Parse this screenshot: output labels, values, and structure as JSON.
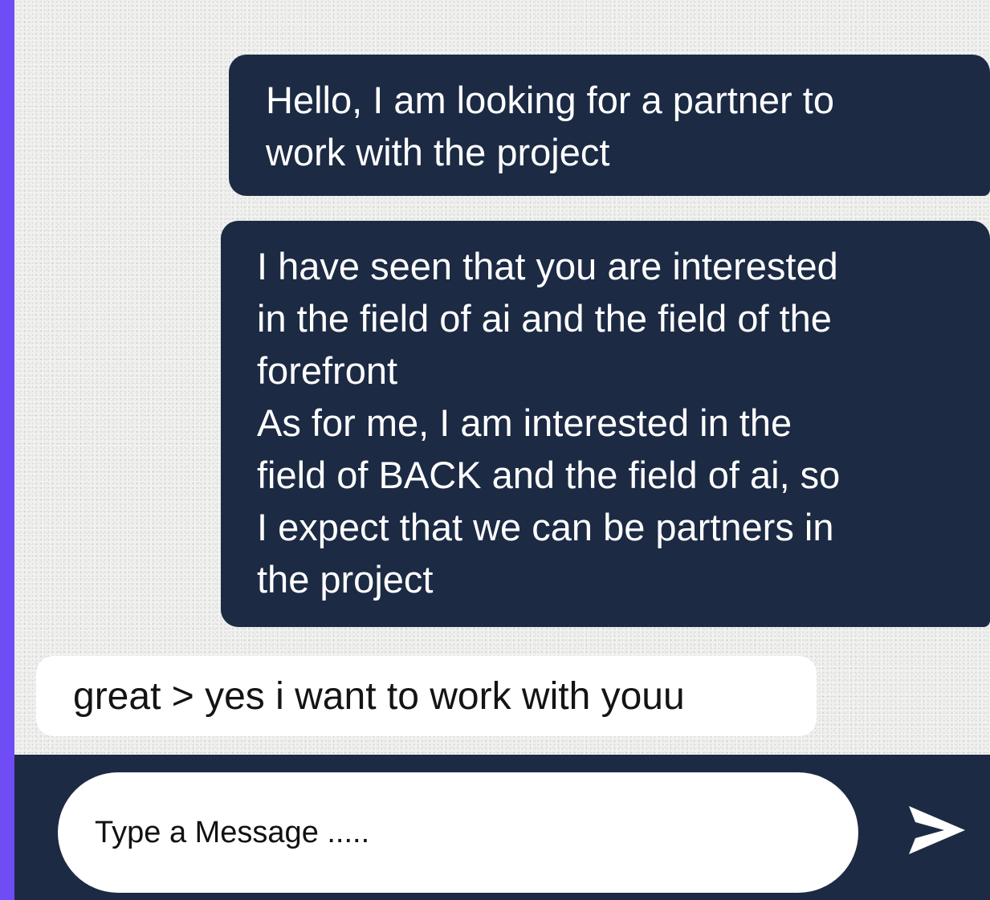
{
  "messages": [
    {
      "sender": "me",
      "text": "Hello, I am looking for a partner to\nwork with the project"
    },
    {
      "sender": "me",
      "text": "I have seen that you are interested\nin the field of ai and the field of the\nforefront\nAs for me, I am interested in the\nfield of BACK and the field of ai, so\nI expect that we can be partners in\nthe project"
    },
    {
      "sender": "other",
      "text": "great > yes i want to work with youu"
    }
  ],
  "composer": {
    "placeholder": "Type a Message .....",
    "value": "",
    "send_icon": "send-icon"
  },
  "colors": {
    "border": "#6f4cf4",
    "sent_bubble": "#1c2a44",
    "received_bubble": "#ffffff",
    "background": "#ececea"
  }
}
